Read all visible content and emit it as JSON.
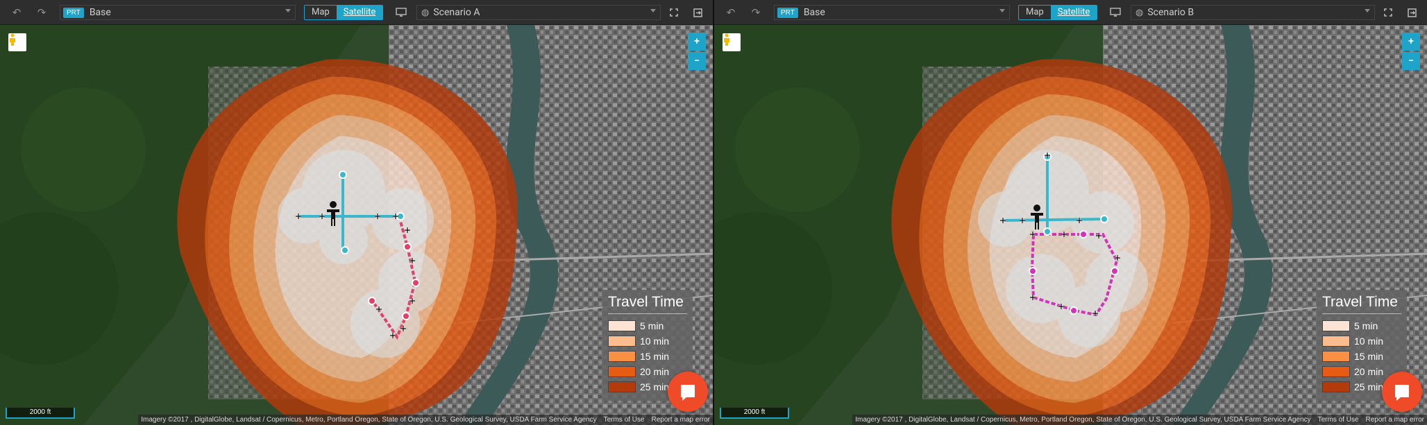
{
  "toolbar": {
    "mode_badge": "PRT",
    "mode_name": "Base",
    "basemap_map": "Map",
    "basemap_satellite": "Satellite"
  },
  "panels": [
    {
      "scenario": "Scenario A"
    },
    {
      "scenario": "Scenario B"
    }
  ],
  "map": {
    "zoom_in": "+",
    "zoom_out": "−",
    "scale_label": "2000 ft",
    "attribution": "Imagery ©2017 , DigitalGlobe, Landsat / Copernicus, Metro, Portland Oregon, State of Oregon, U.S. Geological Survey, USDA Farm Service Agency",
    "terms": "Terms of Use",
    "report": "Report a map error"
  },
  "legend": {
    "title": "Travel Time",
    "items": [
      {
        "label": "5 min",
        "color": "#fde3d3"
      },
      {
        "label": "10 min",
        "color": "#fbbd8d"
      },
      {
        "label": "15 min",
        "color": "#f99044"
      },
      {
        "label": "20 min",
        "color": "#e75c14"
      },
      {
        "label": "25 min",
        "color": "#b23a0b"
      }
    ]
  },
  "colors": {
    "accent": "#1ea3c9",
    "route_base": "#3ab7cc",
    "route_a": "#e0406a",
    "route_b": "#d035b8",
    "chat": "#f04b28"
  }
}
